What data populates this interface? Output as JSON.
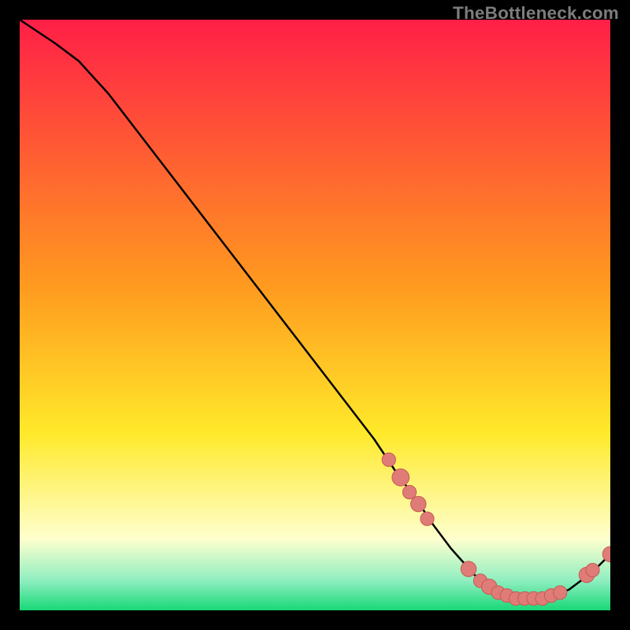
{
  "watermark": "TheBottleneck.com",
  "colors": {
    "gradient_top": "#ff1f47",
    "gradient_mid_orange": "#ff9a1f",
    "gradient_mid_yellow": "#ffe92a",
    "gradient_pale_yellow": "#feffce",
    "gradient_green_light": "#8eeec0",
    "gradient_green": "#18d877",
    "dot_fill": "#e07c77",
    "dot_stroke": "#c65a54",
    "curve": "#000000",
    "frame": "#000000"
  },
  "chart_data": {
    "type": "line",
    "title": "",
    "xlabel": "",
    "ylabel": "",
    "xlim": [
      0,
      100
    ],
    "ylim": [
      0,
      100
    ],
    "grid": false,
    "legend": false,
    "series": [
      {
        "name": "bottleneck-curve",
        "x": [
          0,
          3,
          6,
          10,
          15,
          20,
          25,
          30,
          35,
          40,
          45,
          50,
          55,
          60,
          64,
          67,
          70,
          73,
          77,
          81,
          85,
          89,
          93,
          97,
          100
        ],
        "y": [
          100,
          98,
          96,
          93,
          87.5,
          81,
          74.5,
          68,
          61.5,
          55,
          48.5,
          42,
          35.5,
          29,
          23,
          19,
          14.5,
          10.5,
          6,
          3,
          2,
          2,
          3.5,
          6.5,
          9.5
        ]
      }
    ],
    "dots": [
      {
        "x": 62.5,
        "y": 25.5,
        "r": 1.0
      },
      {
        "x": 64.5,
        "y": 22.5,
        "r": 1.4
      },
      {
        "x": 66.0,
        "y": 20.0,
        "r": 1.0
      },
      {
        "x": 67.5,
        "y": 18.0,
        "r": 1.2
      },
      {
        "x": 69.0,
        "y": 15.5,
        "r": 1.0
      },
      {
        "x": 76.0,
        "y": 7.0,
        "r": 1.2
      },
      {
        "x": 78.0,
        "y": 5.0,
        "r": 1.0
      },
      {
        "x": 79.5,
        "y": 4.0,
        "r": 1.2
      },
      {
        "x": 81.0,
        "y": 3.0,
        "r": 1.0
      },
      {
        "x": 82.5,
        "y": 2.5,
        "r": 1.0
      },
      {
        "x": 84.0,
        "y": 2.0,
        "r": 1.0
      },
      {
        "x": 85.5,
        "y": 2.0,
        "r": 1.0
      },
      {
        "x": 87.0,
        "y": 2.0,
        "r": 1.0
      },
      {
        "x": 88.5,
        "y": 2.0,
        "r": 1.0
      },
      {
        "x": 90.0,
        "y": 2.5,
        "r": 1.0
      },
      {
        "x": 91.5,
        "y": 3.0,
        "r": 1.0
      },
      {
        "x": 96.0,
        "y": 6.0,
        "r": 1.2
      },
      {
        "x": 97.0,
        "y": 6.8,
        "r": 1.0
      },
      {
        "x": 100.0,
        "y": 9.5,
        "r": 1.2
      }
    ]
  }
}
